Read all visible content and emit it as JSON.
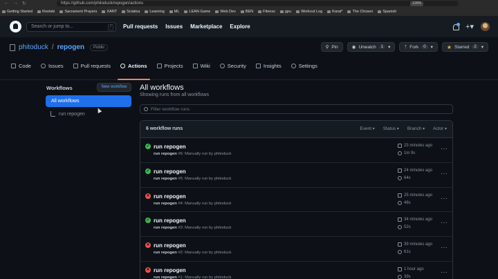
{
  "browser": {
    "url": "https://github.com/phitoduck/repogen/actions",
    "zoom": "120%",
    "bookmarks": [
      "Getting Started",
      "Rootski",
      "Sacrament Prayers",
      "XANT",
      "Sciatica",
      "Learning",
      "ML",
      "LEAN Game",
      "Web Dev",
      "BEN",
      "Fitness",
      "gpu",
      "Workout Log",
      "Karat*",
      "The Chosen",
      "Spanish"
    ]
  },
  "header": {
    "search_placeholder": "Search or jump to...",
    "search_hotkey": "/",
    "links": [
      "Pull requests",
      "Issues",
      "Marketplace",
      "Explore"
    ]
  },
  "repo": {
    "owner": "phitoduck",
    "separator": "/",
    "name": "repogen",
    "visibility": "Public",
    "actions": {
      "pin": "Pin",
      "unwatch": "Unwatch",
      "watch_count": "1",
      "fork": "Fork",
      "fork_count": "0",
      "starred": "Starred",
      "star_count": "2"
    },
    "tabs": [
      "Code",
      "Issues",
      "Pull requests",
      "Actions",
      "Projects",
      "Wiki",
      "Security",
      "Insights",
      "Settings"
    ],
    "active_tab": "Actions"
  },
  "sidebar": {
    "heading": "Workflows",
    "new_button": "New workflow",
    "all_label": "All workflows",
    "workflow": "run repogen"
  },
  "main": {
    "title": "All workflows",
    "subtitle": "Showing runs from all workflows",
    "filter_placeholder": "Filter workflow runs",
    "run_count": "6 workflow runs",
    "filters": [
      "Event",
      "Status",
      "Branch",
      "Actor"
    ],
    "runs": [
      {
        "status": "success",
        "title": "run repogen",
        "desc_bold": "run repogen",
        "desc": " #6: Manually run by phitoduck",
        "time": "23 minutes ago",
        "duration": "1m 9s"
      },
      {
        "status": "success",
        "title": "run repogen",
        "desc_bold": "run repogen",
        "desc": " #5: Manually run by phitoduck",
        "time": "24 minutes ago",
        "duration": "64s"
      },
      {
        "status": "failure",
        "title": "run repogen",
        "desc_bold": "run repogen",
        "desc": " #4: Manually run by phitoduck",
        "time": "25 minutes ago",
        "duration": "48s"
      },
      {
        "status": "success",
        "title": "run repogen",
        "desc_bold": "run repogen",
        "desc": " #3: Manually run by phitoduck",
        "time": "34 minutes ago",
        "duration": "52s"
      },
      {
        "status": "failure",
        "title": "run repogen",
        "desc_bold": "run repogen",
        "desc": " #2: Manually run by phitoduck",
        "time": "39 minutes ago",
        "duration": "61s"
      },
      {
        "status": "failure",
        "title": "run repogen",
        "desc_bold": "run repogen",
        "desc": " #1: Manually run by phitoduck",
        "time": "1 hour ago",
        "duration": "39s"
      }
    ]
  }
}
